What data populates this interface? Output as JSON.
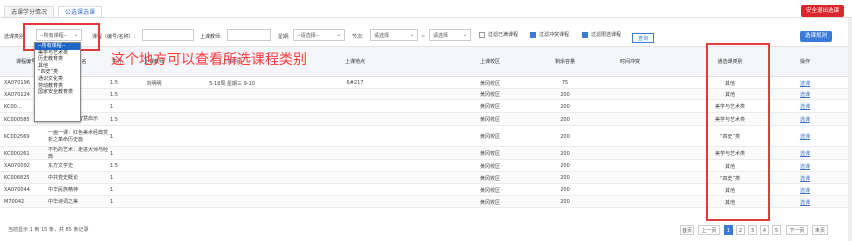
{
  "tabs": [
    {
      "label": "选课学分情况"
    },
    {
      "label": "公选课选课"
    }
  ],
  "safe_exit": "安全退出选课",
  "filters": {
    "category_label": "选课类别:",
    "category_value": "--所有课程--",
    "course_label": "课程（编号/名称）:",
    "teacher_label": "上课教师:",
    "weekday_label": "星期:",
    "weekday_value": "--请选择--",
    "section_label": "节次:",
    "section_from": "请选择",
    "section_sep": "~",
    "section_to": "请选择",
    "filter_full": "过滤已满课程",
    "filter_conflict": "过滤冲突课程",
    "filter_limit": "过滤限选课程",
    "query_btn": "查询"
  },
  "select_btn": "选课规则",
  "annotation": "这个地方可以查看所选课程类别",
  "dropdown": [
    "--所有课程--",
    "美学与艺术类",
    "历史教育类",
    "其他",
    "“四史”类",
    "通识文化类",
    "劳动教育类",
    "国家安全教育类"
  ],
  "headers": {
    "code": "课程编号",
    "name": "课程名",
    "credit": "学分",
    "teacher": "上课教师",
    "time": "上课时间",
    "place": "上课地点",
    "campus": "上课校区",
    "remain": "剩余容量",
    "conflict": "时间冲突",
    "category": "通选课类别",
    "op": "操作"
  },
  "rows": [
    {
      "code": "XA070196",
      "name": "…事汇",
      "credit": "1.5",
      "teacher": "刘明明",
      "time": "5-16周 星期三 9-10",
      "place": "6#217",
      "campus": "黄冈校区",
      "remain": "75",
      "conflict": "",
      "category": "其他",
      "op": "选课"
    },
    {
      "code": "XA070124",
      "name": "…驾",
      "credit": "1.5",
      "teacher": "",
      "time": "",
      "place": "",
      "campus": "黄冈校区",
      "remain": "200",
      "conflict": "",
      "category": "其他",
      "op": "选课"
    },
    {
      "code": "KC00…",
      "name": "…",
      "credit": "1",
      "teacher": "",
      "time": "",
      "place": "",
      "campus": "黄冈校区",
      "remain": "200",
      "conflict": "",
      "category": "美学与艺术类",
      "op": "选课"
    },
    {
      "code": "KC000585",
      "name": "《西游记》的智慧启示",
      "credit": "1.5",
      "teacher": "",
      "time": "",
      "place": "",
      "campus": "黄冈校区",
      "remain": "200",
      "conflict": "",
      "category": "美学与艺术类",
      "op": "选课"
    },
    {
      "code": "KC002569",
      "name": "一画一课：红色美术经典赏析之革命历史篇",
      "credit": "1",
      "teacher": "",
      "time": "",
      "place": "",
      "campus": "黄冈校区",
      "remain": "200",
      "conflict": "",
      "category": "“四史”类",
      "op": "选课"
    },
    {
      "code": "KC000261",
      "name": "不朽的艺术：走进大师与经典",
      "credit": "1",
      "teacher": "",
      "time": "",
      "place": "",
      "campus": "黄冈校区",
      "remain": "200",
      "conflict": "",
      "category": "美学与艺术类",
      "op": "选课"
    },
    {
      "code": "XA070092",
      "name": "东方文学史",
      "credit": "1.5",
      "teacher": "",
      "time": "",
      "place": "",
      "campus": "黄冈校区",
      "remain": "200",
      "conflict": "",
      "category": "其他",
      "op": "选课"
    },
    {
      "code": "KC006825",
      "name": "中共党史概论",
      "credit": "1",
      "teacher": "",
      "time": "",
      "place": "",
      "campus": "黄冈校区",
      "remain": "200",
      "conflict": "",
      "category": "“四史”类",
      "op": "选课"
    },
    {
      "code": "XA070044",
      "name": "中华民族精神",
      "credit": "1",
      "teacher": "",
      "time": "",
      "place": "",
      "campus": "黄冈校区",
      "remain": "200",
      "conflict": "",
      "category": "其他",
      "op": "选课"
    },
    {
      "code": "M70042",
      "name": "中华诗词之美",
      "credit": "1",
      "teacher": "",
      "time": "",
      "place": "",
      "campus": "黄冈校区",
      "remain": "200",
      "conflict": "",
      "category": "其他",
      "op": "选课"
    }
  ],
  "footer": "当前显示 1 到 15 条，共 85 条记录",
  "pager": {
    "first": "首页",
    "prev": "上一页",
    "pages": [
      "1",
      "2",
      "3",
      "4",
      "5"
    ],
    "next": "下一页",
    "last": "末页"
  }
}
